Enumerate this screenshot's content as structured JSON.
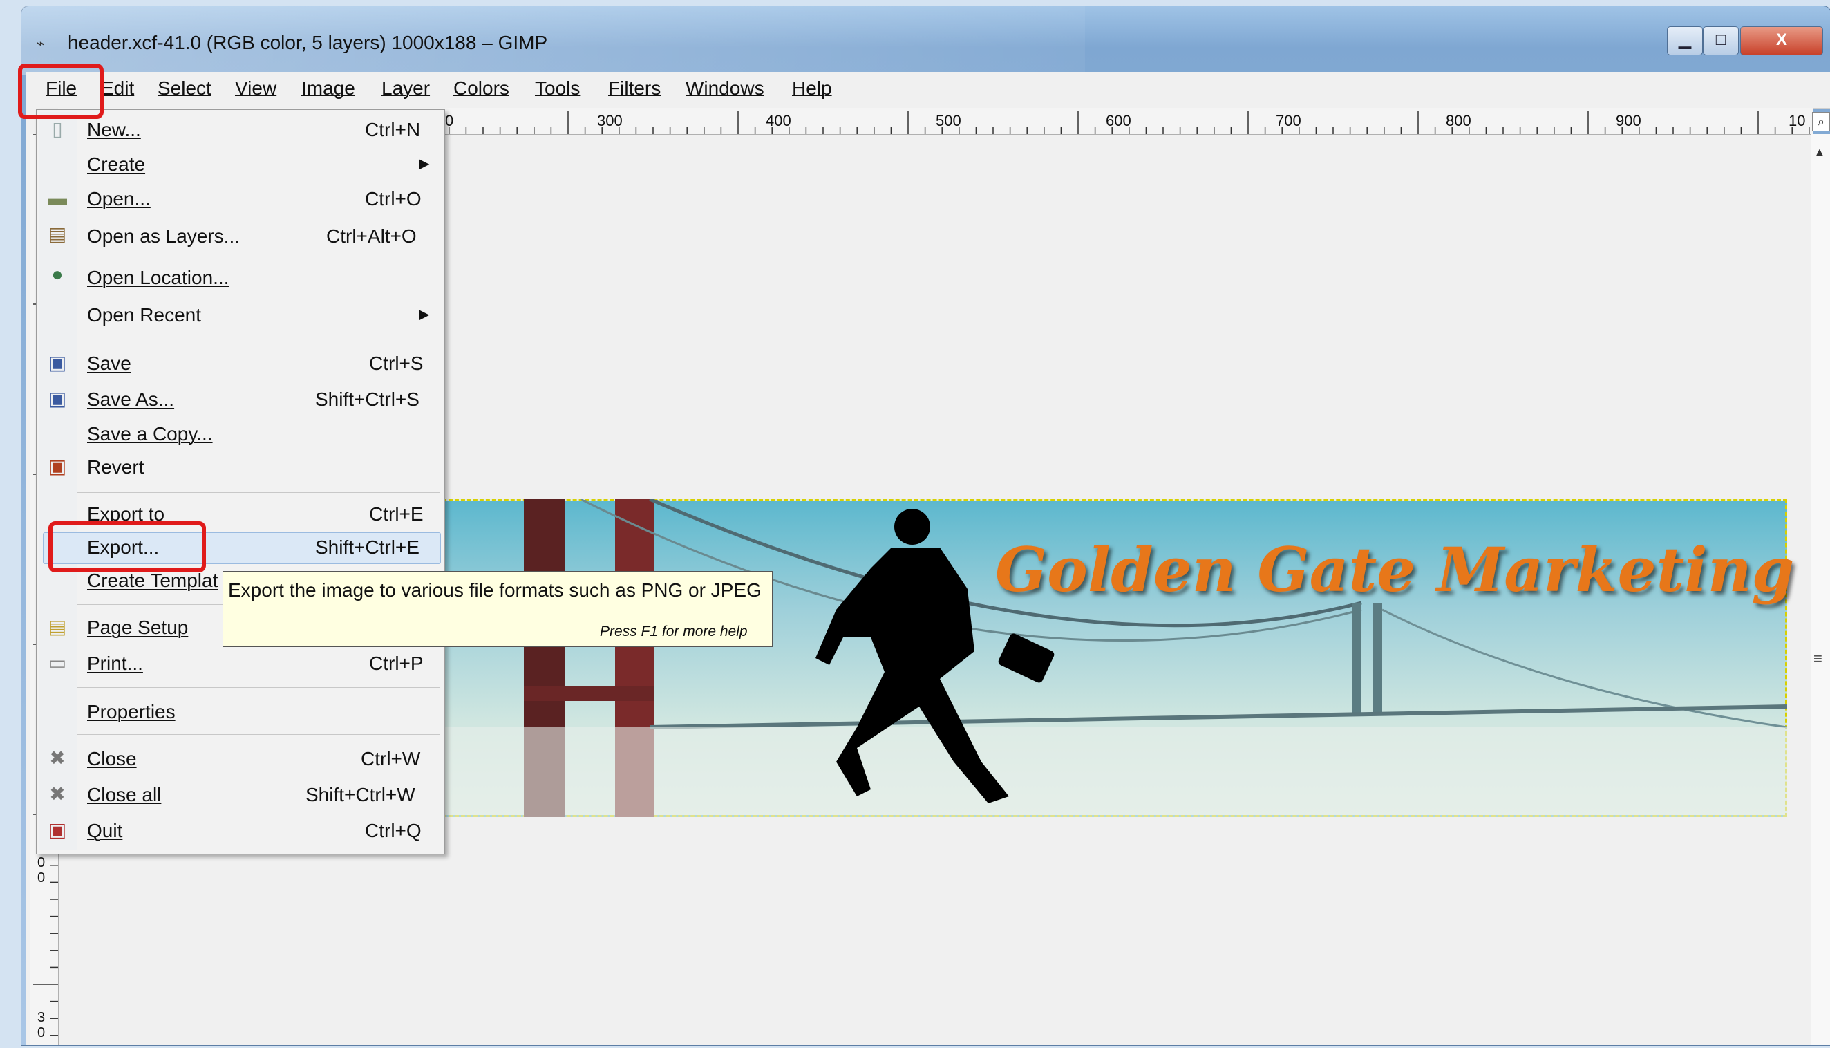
{
  "window": {
    "title": "header.xcf-41.0 (RGB color, 5 layers) 1000x188 – GIMP",
    "icon": "gimp-wilber-icon",
    "controls": {
      "minimize": "▁",
      "maximize": "□",
      "close": "X"
    }
  },
  "menubar": {
    "items": [
      "File",
      "Edit",
      "Select",
      "View",
      "Image",
      "Layer",
      "Colors",
      "Tools",
      "Filters",
      "Windows",
      "Help"
    ]
  },
  "ruler": {
    "h_labels": [
      "0",
      "300",
      "400",
      "500",
      "600",
      "700",
      "800",
      "900",
      "10"
    ],
    "v_labels": [
      "0",
      "0",
      "3",
      "0"
    ]
  },
  "file_menu": {
    "items": [
      {
        "label": "New...",
        "shortcut": "Ctrl+N",
        "icon": "new-file-icon"
      },
      {
        "label": "Create",
        "shortcut": "",
        "icon": "",
        "submenu": true
      },
      {
        "label": "Open...",
        "shortcut": "Ctrl+O",
        "icon": "folder-open-icon"
      },
      {
        "label": "Open as Layers...",
        "shortcut": "Ctrl+Alt+O",
        "icon": "open-layers-icon"
      },
      {
        "label": "Open Location...",
        "shortcut": "",
        "icon": "globe-icon"
      },
      {
        "label": "Open Recent",
        "shortcut": "",
        "icon": "",
        "submenu": true
      },
      {
        "label": "Save",
        "shortcut": "Ctrl+S",
        "icon": "save-icon"
      },
      {
        "label": "Save As...",
        "shortcut": "Shift+Ctrl+S",
        "icon": "save-as-icon"
      },
      {
        "label": "Save a Copy...",
        "shortcut": "",
        "icon": ""
      },
      {
        "label": "Revert",
        "shortcut": "",
        "icon": "revert-icon"
      },
      {
        "label": "Export to",
        "shortcut": "Ctrl+E",
        "icon": ""
      },
      {
        "label": "Export...",
        "shortcut": "Shift+Ctrl+E",
        "icon": ""
      },
      {
        "label": "Create Templat",
        "shortcut": "",
        "icon": ""
      },
      {
        "label": "Page Setup",
        "shortcut": "",
        "icon": "page-setup-icon"
      },
      {
        "label": "Print...",
        "shortcut": "Ctrl+P",
        "icon": "printer-icon"
      },
      {
        "label": "Properties",
        "shortcut": "",
        "icon": ""
      },
      {
        "label": "Close",
        "shortcut": "Ctrl+W",
        "icon": "close-x-icon"
      },
      {
        "label": "Close all",
        "shortcut": "Shift+Ctrl+W",
        "icon": "close-all-icon"
      },
      {
        "label": "Quit",
        "shortcut": "Ctrl+Q",
        "icon": "quit-icon"
      }
    ]
  },
  "tooltip": {
    "text": "Export the image to various file formats such as PNG or JPEG",
    "help": "Press F1 for more help"
  },
  "image": {
    "banner_text": "Golden Gate Marketing",
    "text_color": "#e7771a"
  },
  "colors": {
    "annotation_red": "#e01b1b",
    "highlight": "#dbe8f6",
    "tooltip_bg": "#ffffe1"
  }
}
